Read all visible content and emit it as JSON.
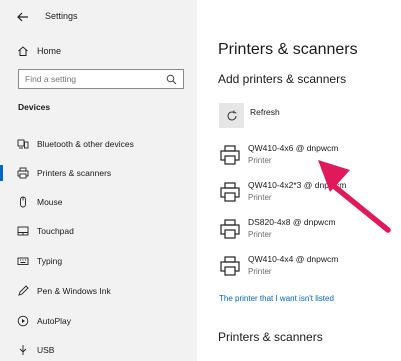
{
  "app": {
    "title": "Settings"
  },
  "sidebar": {
    "home_label": "Home",
    "search_placeholder": "Find a setting",
    "section_label": "Devices",
    "items": [
      {
        "label": "Bluetooth & other devices",
        "icon": "bluetooth-devices-icon"
      },
      {
        "label": "Printers & scanners",
        "icon": "printer-icon",
        "active": true
      },
      {
        "label": "Mouse",
        "icon": "mouse-icon"
      },
      {
        "label": "Touchpad",
        "icon": "touchpad-icon"
      },
      {
        "label": "Typing",
        "icon": "keyboard-icon"
      },
      {
        "label": "Pen & Windows Ink",
        "icon": "pen-icon"
      },
      {
        "label": "AutoPlay",
        "icon": "autoplay-icon"
      },
      {
        "label": "USB",
        "icon": "usb-icon"
      }
    ]
  },
  "main": {
    "title": "Printers & scanners",
    "add_heading": "Add printers & scanners",
    "refresh_label": "Refresh",
    "printers": [
      {
        "name": "QW410-4x6 @ dnpwcm",
        "type": "Printer"
      },
      {
        "name": "QW410-4x2*3 @ dnpwcm",
        "type": "Printer"
      },
      {
        "name": "DS820-4x8 @ dnpwcm",
        "type": "Printer"
      },
      {
        "name": "QW410-4x4 @ dnpwcm",
        "type": "Printer"
      }
    ],
    "not_listed_link": "The printer that I want isn't listed",
    "bottom_heading": "Printers & scanners"
  },
  "colors": {
    "accent": "#0067c0",
    "annotation_arrow": "#e0195a",
    "sidebar_bg": "#f2f2f2"
  }
}
